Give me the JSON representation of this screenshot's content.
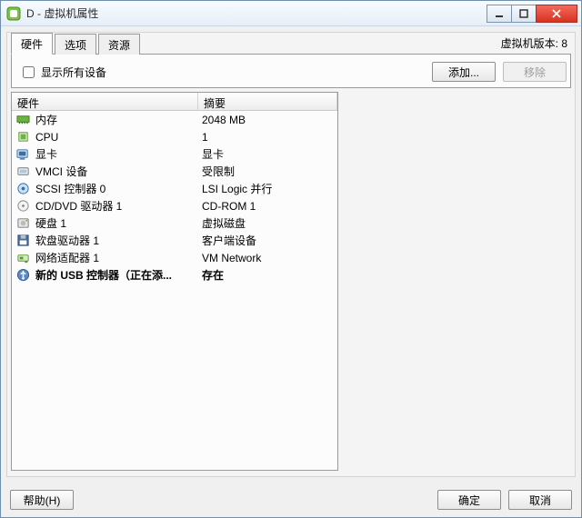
{
  "window": {
    "title": "D - 虚拟机属性"
  },
  "tabs": {
    "hardware": "硬件",
    "options": "选项",
    "resources": "资源"
  },
  "vm_version_label": "虚拟机版本: 8",
  "toolbar": {
    "show_all_label": "显示所有设备",
    "add_label": "添加...",
    "remove_label": "移除"
  },
  "columns": {
    "hardware": "硬件",
    "summary": "摘要"
  },
  "rows": [
    {
      "icon": "memory",
      "hw": "内存",
      "sum": "2048 MB",
      "bold": false
    },
    {
      "icon": "cpu",
      "hw": "CPU",
      "sum": "1",
      "bold": false
    },
    {
      "icon": "video",
      "hw": "显卡",
      "sum": "显卡",
      "bold": false
    },
    {
      "icon": "vmci",
      "hw": "VMCI 设备",
      "sum": "受限制",
      "bold": false
    },
    {
      "icon": "scsi",
      "hw": "SCSI 控制器 0",
      "sum": "LSI Logic 并行",
      "bold": false
    },
    {
      "icon": "cdrom",
      "hw": "CD/DVD 驱动器 1",
      "sum": "CD-ROM 1",
      "bold": false
    },
    {
      "icon": "disk",
      "hw": "硬盘 1",
      "sum": "虚拟磁盘",
      "bold": false
    },
    {
      "icon": "floppy",
      "hw": "软盘驱动器 1",
      "sum": "客户端设备",
      "bold": false
    },
    {
      "icon": "nic",
      "hw": "网络适配器 1",
      "sum": "VM Network",
      "bold": false
    },
    {
      "icon": "usb",
      "hw": "新的 USB 控制器（正在添...",
      "sum": "存在",
      "bold": true
    }
  ],
  "footer": {
    "help": "帮助(H)",
    "ok": "确定",
    "cancel": "取消"
  }
}
